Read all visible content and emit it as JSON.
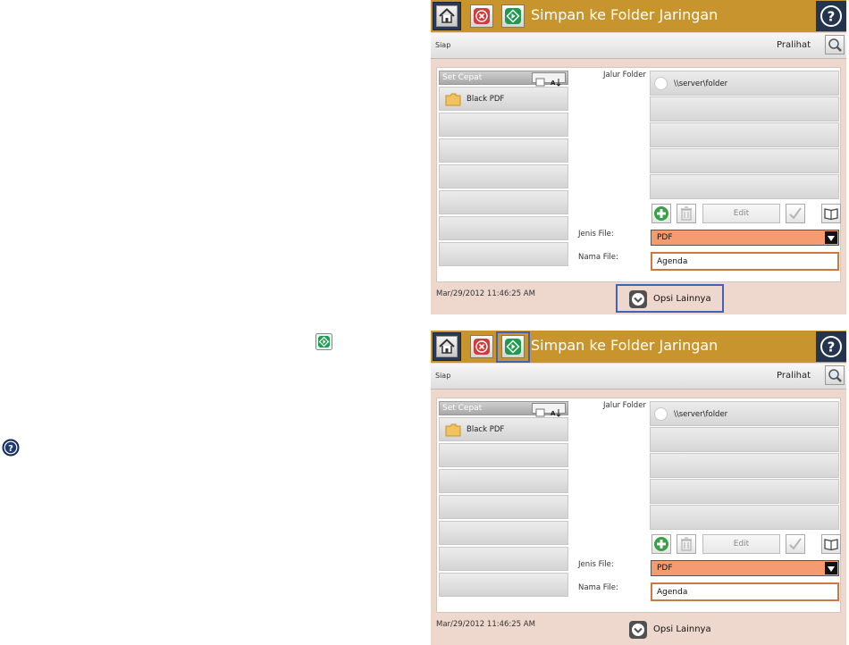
{
  "inline_icons": {
    "start": "start-icon",
    "help": "help-icon"
  },
  "panels": [
    {
      "title": "Simpan ke Folder Jaringan",
      "status": "Siap",
      "preview_label": "Pralihat",
      "quick_sets": {
        "header": "Set Cepat",
        "items": [
          "Black PDF"
        ]
      },
      "folder_path_label": "Jalur Folder",
      "folder_paths": [
        "\\\\server\\folder"
      ],
      "edit_label": "Edit",
      "file_type_label": "Jenis File:",
      "file_type_value": "PDF",
      "file_name_label": "Nama File:",
      "file_name_value": "Agenda",
      "datetime": "Mar/29/2012 11:46:25 AM",
      "more_options_label": "Opsi Lainnya",
      "highlight": "more-options"
    },
    {
      "title": "Simpan ke Folder Jaringan",
      "status": "Siap",
      "preview_label": "Pralihat",
      "quick_sets": {
        "header": "Set Cepat",
        "items": [
          "Black PDF"
        ]
      },
      "folder_path_label": "Jalur Folder",
      "folder_paths": [
        "\\\\server\\folder"
      ],
      "edit_label": "Edit",
      "file_type_label": "Jenis File:",
      "file_type_value": "PDF",
      "file_name_label": "Nama File:",
      "file_name_value": "Agenda",
      "datetime": "Mar/29/2012 11:46:25 AM",
      "more_options_label": "Opsi Lainnya",
      "highlight": "start-button"
    }
  ],
  "colors": {
    "title_bar": "#c8942e",
    "panel_bg": "#eed7cd",
    "highlight": "#3e63b8",
    "dropdown": "#f49b70",
    "name_field_border": "#cc7840",
    "stop_red": "#d23b3b",
    "start_green": "#1f9a4e"
  }
}
